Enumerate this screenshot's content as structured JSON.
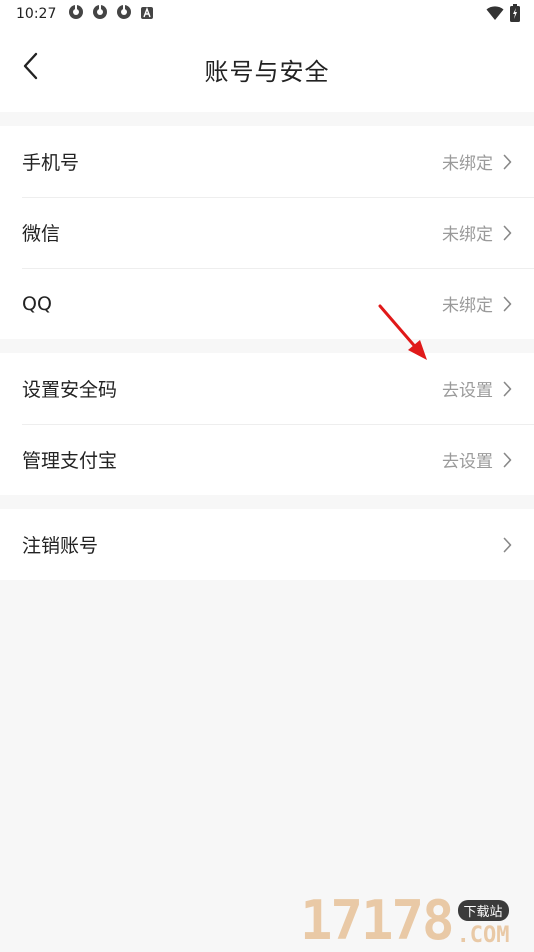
{
  "status_bar": {
    "time": "10:27",
    "left_icons": [
      "notification-icon",
      "notification-icon",
      "notification-icon",
      "accessibility-a-icon"
    ],
    "right_icons": [
      "wifi-icon",
      "battery-icon"
    ]
  },
  "header": {
    "title": "账号与安全",
    "back_icon": "back-arrow-icon"
  },
  "sections": [
    {
      "rows": [
        {
          "label": "手机号",
          "value": "未绑定"
        },
        {
          "label": "微信",
          "value": "未绑定"
        },
        {
          "label": "QQ",
          "value": "未绑定"
        }
      ]
    },
    {
      "rows": [
        {
          "label": "设置安全码",
          "value": "去设置"
        },
        {
          "label": "管理支付宝",
          "value": "去设置"
        }
      ]
    },
    {
      "rows": [
        {
          "label": "注销账号",
          "value": ""
        }
      ]
    }
  ],
  "watermark": {
    "number": "17178",
    "badge_top": "下载站",
    "badge_bottom": ".COM"
  },
  "colors": {
    "page_background": "#f7f7f7",
    "row_value": "#9a9a9a",
    "annotation_arrow": "#e01919"
  }
}
